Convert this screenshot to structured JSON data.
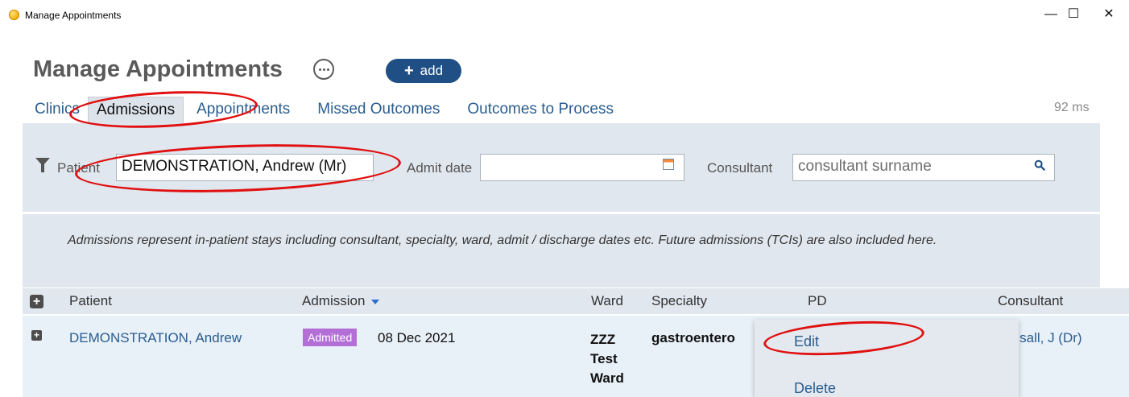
{
  "window": {
    "title": "Manage Appointments",
    "minimize": "—",
    "maximize": "☐",
    "close": "✕"
  },
  "header": {
    "title": "Manage Appointments",
    "add_label": "add",
    "add_plus": "+"
  },
  "tabs": [
    {
      "label": "Clinics",
      "active": false
    },
    {
      "label": "Admissions",
      "active": true
    },
    {
      "label": "Appointments",
      "active": false
    },
    {
      "label": "Missed Outcomes",
      "active": false
    },
    {
      "label": "Outcomes to Process",
      "active": false
    }
  ],
  "timing": "92 ms",
  "filters": {
    "patient_label": "Patient",
    "patient_value": "DEMONSTRATION, Andrew (Mr)",
    "admit_date_label": "Admit date",
    "admit_date_value": "",
    "consultant_label": "Consultant",
    "consultant_placeholder": "consultant surname"
  },
  "info_text": "Admissions represent in-patient stays including consultant, specialty, ward, admit / discharge dates etc. Future admissions (TCIs) are also included here.",
  "table": {
    "columns": [
      "Patient",
      "Admission",
      "Ward",
      "Specialty",
      "PD",
      "Consultant"
    ],
    "rows": [
      {
        "patient": "DEMONSTRATION, Andrew",
        "status": "Admitted",
        "admission": "08 Dec 2021",
        "ward_lines": [
          "ZZZ",
          "Test",
          "Ward"
        ],
        "specialty": "gastroentero",
        "consultant": "rdsall, J (Dr)"
      }
    ]
  },
  "context_menu": {
    "items": [
      "Edit",
      "Delete"
    ]
  },
  "colors": {
    "accent": "#1f4f85",
    "link": "#2a5d8f",
    "badge": "#b36fd6",
    "annotation": "#e01010"
  }
}
